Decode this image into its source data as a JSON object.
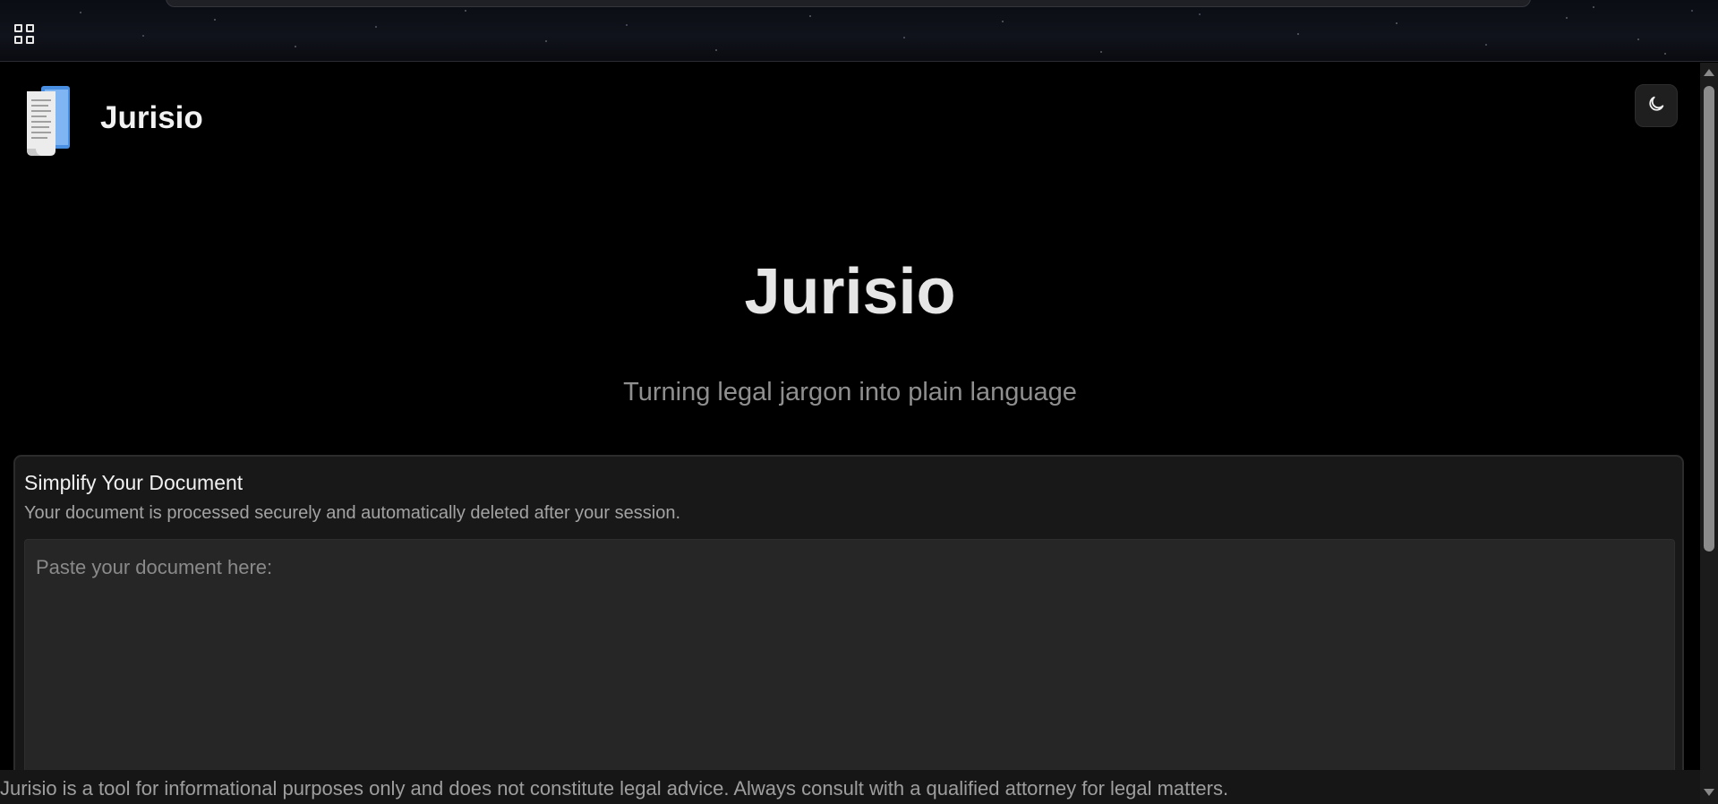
{
  "browser": {
    "apps_icon": "apps-grid-icon"
  },
  "header": {
    "brand": "Jurisio",
    "logo_icon": "document-scroll-icon",
    "theme_icon": "moon-icon"
  },
  "hero": {
    "title": "Jurisio",
    "subtitle": "Turning legal jargon into plain language"
  },
  "card": {
    "title": "Simplify Your Document",
    "description": "Your document is processed securely and automatically deleted after your session.",
    "input_placeholder": "Paste your document here:"
  },
  "footer": {
    "disclaimer": "Jurisio is a tool for informational purposes only and does not constitute legal advice. Always consult with a qualified attorney for legal matters."
  },
  "colors": {
    "page_background": "#000000",
    "card_background": "#181818",
    "input_background": "#262626",
    "subtitle_text": "#8f8f8f"
  }
}
